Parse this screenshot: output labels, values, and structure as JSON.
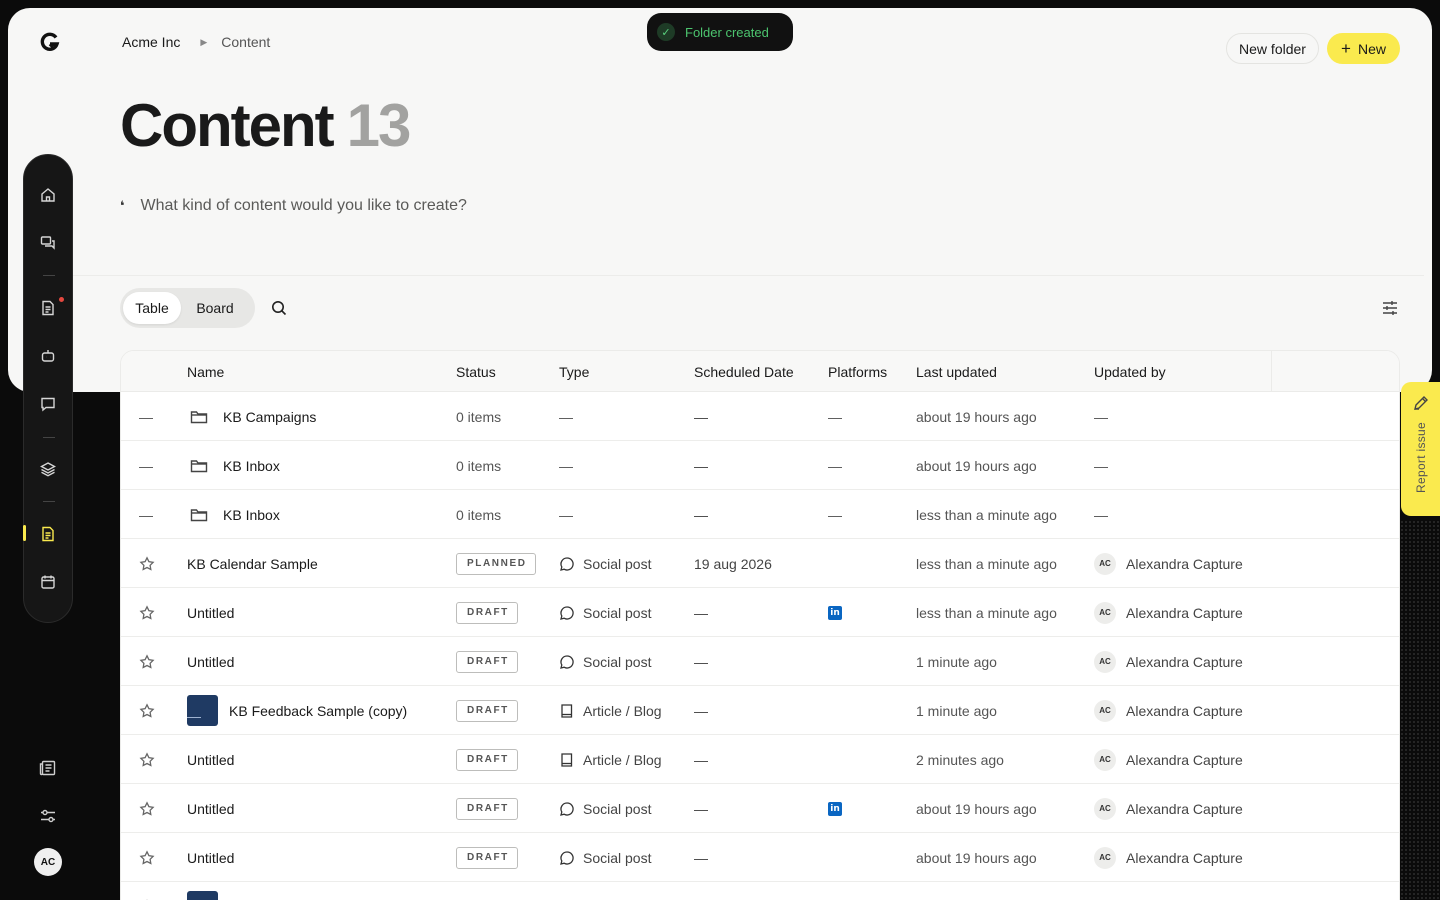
{
  "app": {
    "logo_icon": "g-logo-icon",
    "breadcrumb": {
      "org": "Acme Inc",
      "current": "Content"
    },
    "toast": {
      "text": "Folder created",
      "icon": "check-circle-icon",
      "color": "#4cc46e"
    },
    "actions": {
      "new_folder": "New folder",
      "new_label": "New",
      "new_color": "#faea4e"
    },
    "title": "Content",
    "title_count": "13",
    "prompt_placeholder": "What kind of content would you like to create?"
  },
  "sidebar": {
    "items": [
      {
        "icon": "home-icon"
      },
      {
        "icon": "chat-bubbles-icon"
      },
      {
        "icon": "document-icon",
        "notification": true
      },
      {
        "icon": "robot-icon"
      },
      {
        "icon": "message-icon"
      },
      {
        "icon": "layers-icon"
      },
      {
        "icon": "content-doc-icon",
        "active": true
      },
      {
        "icon": "calendar-icon"
      }
    ],
    "bottom": [
      {
        "icon": "newspaper-icon"
      },
      {
        "icon": "settings-sliders-icon"
      }
    ],
    "avatar_initials": "AC"
  },
  "toolbar": {
    "tabs": [
      "Table",
      "Board"
    ],
    "active_tab": "Table"
  },
  "table": {
    "columns": [
      "Name",
      "Status",
      "Type",
      "Scheduled Date",
      "Platforms",
      "Last updated",
      "Updated by"
    ],
    "rows": [
      {
        "kind": "folder",
        "sel": "—",
        "name": "KB Campaigns",
        "status": "0 items",
        "type": "—",
        "date": "—",
        "platform": "—",
        "updated": "about 19 hours ago",
        "by": "—"
      },
      {
        "kind": "folder",
        "sel": "—",
        "name": "KB Inbox",
        "status": "0 items",
        "type": "—",
        "date": "—",
        "platform": "—",
        "updated": "about 19 hours ago",
        "by": "—"
      },
      {
        "kind": "folder",
        "sel": "—",
        "name": "KB Inbox",
        "status": "0 items",
        "type": "—",
        "date": "—",
        "platform": "—",
        "updated": "less than a minute ago",
        "by": "—"
      },
      {
        "kind": "item",
        "name": "KB Calendar Sample",
        "status": "PLANNED",
        "type": "Social post",
        "type_icon": "speech-bubble-icon",
        "date": "19 aug 2026",
        "platform": "",
        "updated": "less than a minute ago",
        "by_initials": "AC",
        "by": "Alexandra Capture"
      },
      {
        "kind": "item",
        "name": "Untitled",
        "status": "DRAFT",
        "type": "Social post",
        "type_icon": "speech-bubble-icon",
        "date": "—",
        "platform": "linkedin",
        "updated": "less than a minute ago",
        "by_initials": "AC",
        "by": "Alexandra Capture"
      },
      {
        "kind": "item",
        "name": "Untitled",
        "status": "DRAFT",
        "type": "Social post",
        "type_icon": "speech-bubble-icon",
        "date": "—",
        "platform": "",
        "updated": "1 minute ago",
        "by_initials": "AC",
        "by": "Alexandra Capture"
      },
      {
        "kind": "item",
        "thumb": true,
        "name": "KB Feedback Sample (copy)",
        "status": "DRAFT",
        "type": "Article / Blog",
        "type_icon": "book-icon",
        "date": "—",
        "platform": "",
        "updated": "1 minute ago",
        "by_initials": "AC",
        "by": "Alexandra Capture"
      },
      {
        "kind": "item",
        "name": "Untitled",
        "status": "DRAFT",
        "type": "Article / Blog",
        "type_icon": "book-icon",
        "date": "—",
        "platform": "",
        "updated": "2 minutes ago",
        "by_initials": "AC",
        "by": "Alexandra Capture"
      },
      {
        "kind": "item",
        "name": "Untitled",
        "status": "DRAFT",
        "type": "Social post",
        "type_icon": "speech-bubble-icon",
        "date": "—",
        "platform": "linkedin",
        "updated": "about 19 hours ago",
        "by_initials": "AC",
        "by": "Alexandra Capture"
      },
      {
        "kind": "item",
        "name": "Untitled",
        "status": "DRAFT",
        "type": "Social post",
        "type_icon": "speech-bubble-icon",
        "date": "—",
        "platform": "",
        "updated": "about 19 hours ago",
        "by_initials": "AC",
        "by": "Alexandra Capture"
      },
      {
        "kind": "item",
        "thumb": true,
        "name": "",
        "status": "",
        "type": "",
        "date": "",
        "platform": "",
        "updated": "",
        "by_initials": "",
        "by": ""
      }
    ]
  },
  "report_issue": {
    "label": "Report issue",
    "icon": "pencil-icon",
    "color": "#faea4e"
  }
}
